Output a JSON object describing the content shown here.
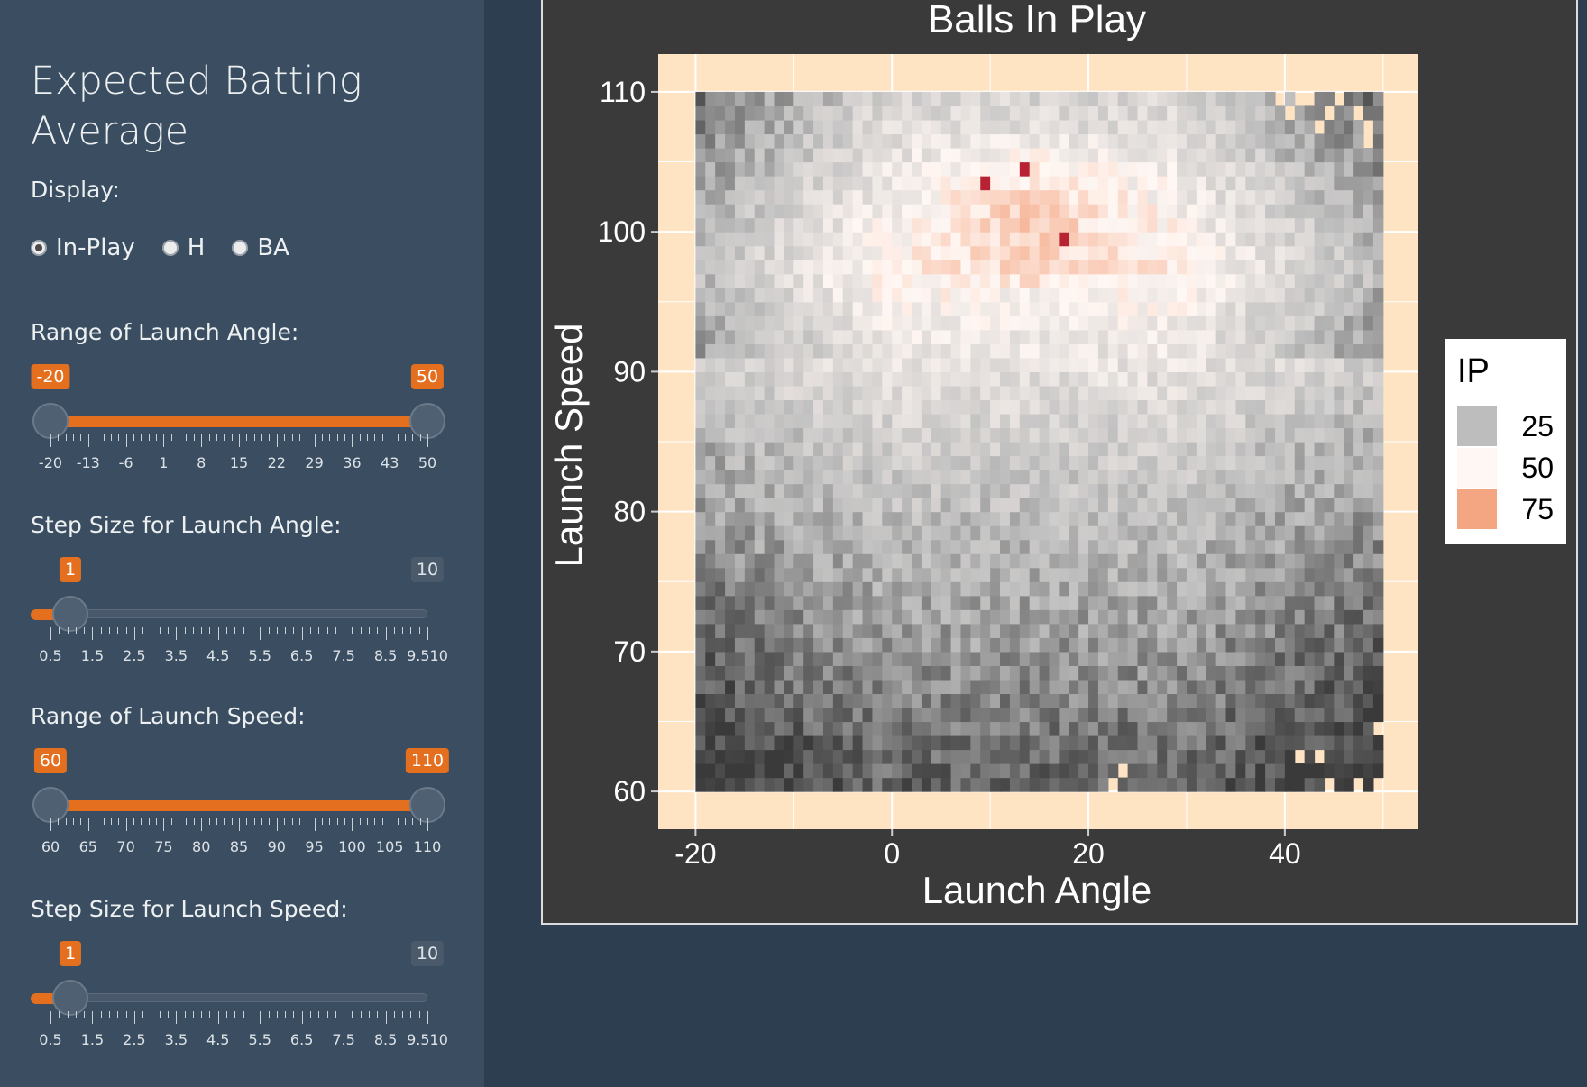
{
  "sidebar": {
    "title": "Expected Batting Average",
    "display_label": "Display:",
    "display_options": [
      {
        "label": "In-Play",
        "checked": true
      },
      {
        "label": "H",
        "checked": false
      },
      {
        "label": "BA",
        "checked": false
      }
    ],
    "sliders": [
      {
        "label": "Range of Launch Angle:",
        "type": "range",
        "min": -20,
        "max": 50,
        "values": [
          -20,
          50
        ],
        "from_label": "-20",
        "to_label": "50",
        "tick_labels": [
          "-20",
          "-13",
          "-6",
          "1",
          "8",
          "15",
          "22",
          "29",
          "36",
          "43",
          "50"
        ]
      },
      {
        "label": "Step Size for Launch Angle:",
        "type": "single",
        "min": 0.5,
        "max": 10,
        "value": 1,
        "value_label": "1",
        "max_label": "10",
        "tick_labels": [
          "0.5",
          "1.5",
          "2.5",
          "3.5",
          "4.5",
          "5.5",
          "6.5",
          "7.5",
          "8.5",
          "9.510"
        ]
      },
      {
        "label": "Range of Launch Speed:",
        "type": "range",
        "min": 60,
        "max": 110,
        "values": [
          60,
          110
        ],
        "from_label": "60",
        "to_label": "110",
        "tick_labels": [
          "60",
          "65",
          "70",
          "75",
          "80",
          "85",
          "90",
          "95",
          "100",
          "105",
          "110"
        ]
      },
      {
        "label": "Step Size for Launch Speed:",
        "type": "single",
        "min": 0.5,
        "max": 10,
        "value": 1,
        "value_label": "1",
        "max_label": "10",
        "tick_labels": [
          "0.5",
          "1.5",
          "2.5",
          "3.5",
          "4.5",
          "5.5",
          "6.5",
          "7.5",
          "8.5",
          "9.510"
        ]
      }
    ]
  },
  "colors": {
    "accent": "#e46f1f",
    "panel_background": "#ffe4c4",
    "low": "#3a3a3a",
    "mid": "#fff7f3",
    "high": "#b2182b"
  },
  "chart_data": {
    "type": "heatmap",
    "title": "Balls In Play",
    "xlabel": "Launch Angle",
    "ylabel": "Launch Speed",
    "xlim": [
      -20,
      50
    ],
    "ylim": [
      60,
      110
    ],
    "x_ticks": [
      -20,
      0,
      20,
      40
    ],
    "y_ticks": [
      60,
      70,
      80,
      90,
      100,
      110
    ],
    "bin_width": 1,
    "legend": {
      "title": "IP",
      "position": "right",
      "entries": [
        {
          "label": "25",
          "color": "#bdbdbd"
        },
        {
          "label": "50",
          "color": "#fff7f3"
        },
        {
          "label": "75",
          "color": "#f4a582"
        }
      ]
    },
    "hot_spot": {
      "x_range": [
        0,
        30
      ],
      "y_range": [
        96,
        106
      ],
      "max_cells": [
        [
          13,
          104
        ],
        [
          17,
          99
        ],
        [
          9,
          103
        ]
      ]
    }
  }
}
